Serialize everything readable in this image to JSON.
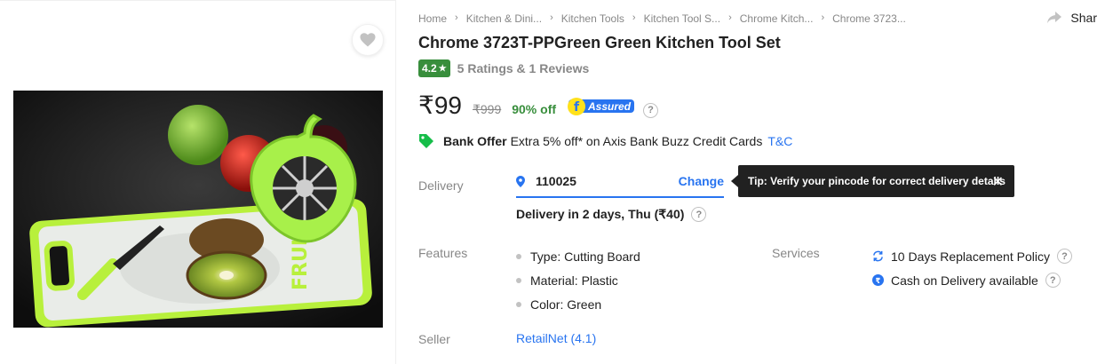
{
  "breadcrumbs": [
    "Home",
    "Kitchen & Dini...",
    "Kitchen Tools",
    "Kitchen Tool S...",
    "Chrome Kitch...",
    "Chrome 3723..."
  ],
  "share_label": "Shar",
  "product": {
    "title": "Chrome 3723T-PPGreen Green Kitchen Tool Set",
    "rating": "4.2",
    "rating_text": "5 Ratings & 1 Reviews",
    "price": "₹99",
    "mrp": "₹999",
    "discount": "90% off",
    "assured_label": "Assured"
  },
  "offer": {
    "title": "Bank Offer",
    "text": "Extra 5% off* on Axis Bank Buzz Credit Cards",
    "link": "T&C"
  },
  "delivery": {
    "label": "Delivery",
    "pincode": "110025",
    "change_label": "Change",
    "tooltip": "Tip: Verify your pincode for correct delivery details",
    "time": "Delivery in 2 days, Thu (₹40)"
  },
  "features": {
    "label": "Features",
    "items": [
      "Type: Cutting Board",
      "Material: Plastic",
      "Color: Green"
    ]
  },
  "services": {
    "label": "Services",
    "items": [
      "10 Days Replacement Policy",
      "Cash on Delivery available"
    ]
  },
  "seller": {
    "label": "Seller",
    "name": "RetailNet (4.1)"
  },
  "colors": {
    "accent": "#2874f0",
    "green": "#388e3c",
    "muted": "#878787"
  }
}
